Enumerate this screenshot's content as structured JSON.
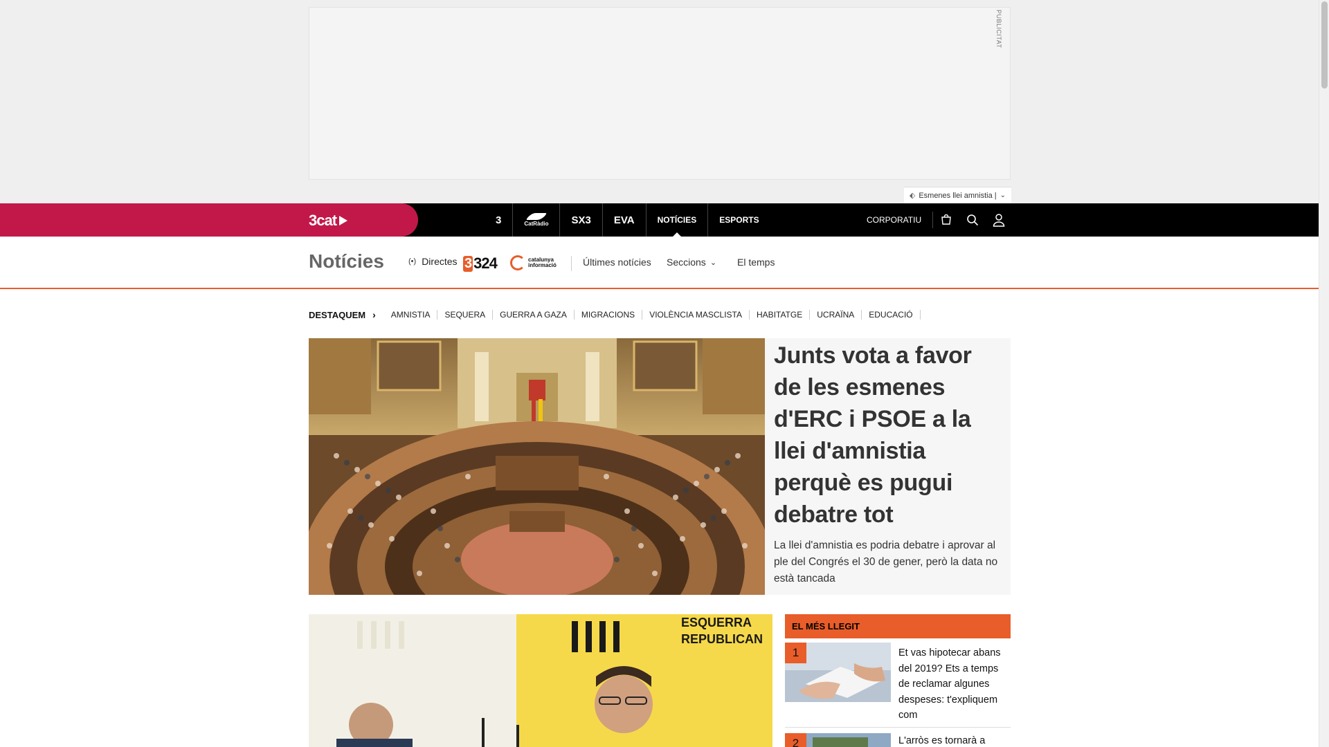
{
  "ad": {
    "label": "PUBLICITAT",
    "tag": "Esmenes llei amnistia |"
  },
  "topnav": {
    "logo": "3cat",
    "channels": [
      "3",
      "CatRàdio",
      "SX3",
      "EVA"
    ],
    "links": [
      "NOTÍCIES",
      "ESPORTS"
    ],
    "corporate": "CORPORATIU",
    "icons": [
      "cart-icon",
      "search-icon",
      "user-icon"
    ]
  },
  "section": {
    "title": "Notícies",
    "directes": "Directes",
    "logo_324": "324",
    "logo_catinfo": [
      "catalunya",
      "informació"
    ],
    "links": {
      "ultimes": "Últimes notícies",
      "seccions": "Seccions",
      "temps": "El temps"
    }
  },
  "destaquem": {
    "label": "DESTAQUEM",
    "tags": [
      "AMNISTIA",
      "SEQUERA",
      "GUERRA A GAZA",
      "MIGRACIONS",
      "VIOLÈNCIA MASCLISTA",
      "HABITATGE",
      "UCRAÏNA",
      "EDUCACIÓ"
    ]
  },
  "lead": {
    "title": "Junts vota a favor de les esmenes d'ERC i PSOE a la llei d'amnistia perquè es pugui debatre tot",
    "subtitle": "La llei d'amnistia es podria debatre i aprovar al ple del Congrés el 30 de gener, però la data no està tancada"
  },
  "second": {
    "banner_text": [
      "ESQUERRA",
      "REPUBLICAN"
    ]
  },
  "mes_llegit": {
    "heading": "EL MÉS LLEGIT",
    "items": [
      {
        "num": "1",
        "title": "Et vas hipotecar abans del 2019? Ets a temps de reclamar algunes despeses: t'expliquem com"
      },
      {
        "num": "2",
        "title": "L'arròs es tornarà a"
      }
    ]
  },
  "colors": {
    "brand": "#c21849",
    "accent": "#e85d2a",
    "nav_bg": "#000000"
  }
}
